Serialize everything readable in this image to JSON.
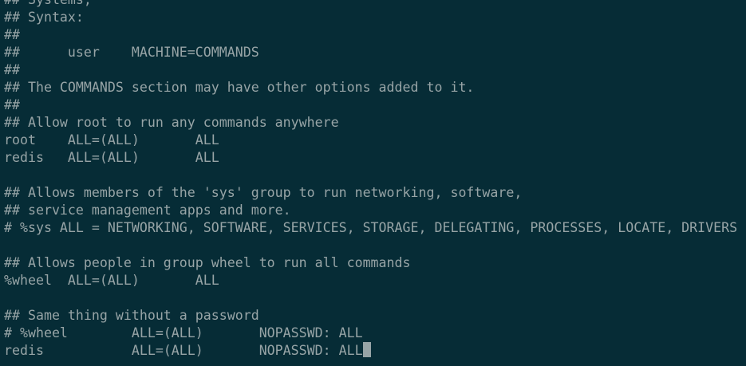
{
  "terminal": {
    "lines": [
      "## Systems,",
      "## Syntax:",
      "##",
      "##      user    MACHINE=COMMANDS",
      "##",
      "## The COMMANDS section may have other options added to it.",
      "##",
      "## Allow root to run any commands anywhere",
      "root    ALL=(ALL)       ALL",
      "redis   ALL=(ALL)       ALL",
      "",
      "## Allows members of the 'sys' group to run networking, software,",
      "## service management apps and more.",
      "# %sys ALL = NETWORKING, SOFTWARE, SERVICES, STORAGE, DELEGATING, PROCESSES, LOCATE, DRIVERS",
      "",
      "## Allows people in group wheel to run all commands",
      "%wheel  ALL=(ALL)       ALL",
      "",
      "## Same thing without a password",
      "# %wheel        ALL=(ALL)       NOPASSWD: ALL",
      "redis           ALL=(ALL)       NOPASSWD: ALL"
    ]
  }
}
